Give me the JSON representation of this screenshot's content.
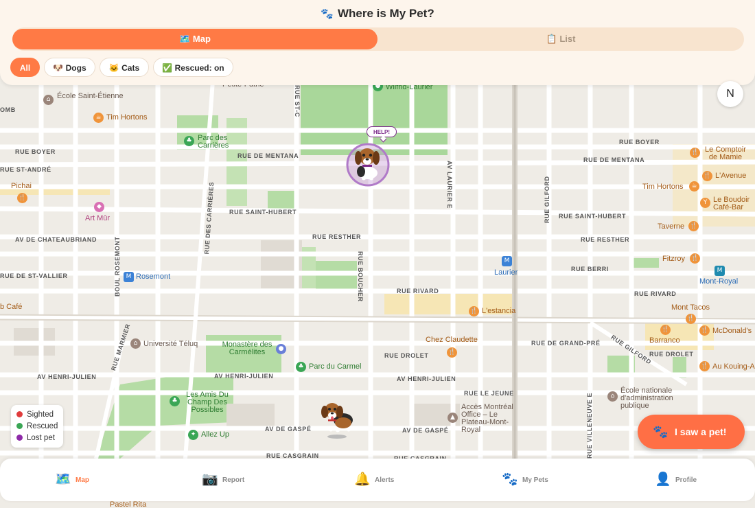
{
  "app": {
    "title": "Where is My Pet?"
  },
  "view_toggle": {
    "map_label": "🗺️ Map",
    "list_label": "📋 List",
    "selected": "Map"
  },
  "filters": [
    {
      "label": "All",
      "active": true
    },
    {
      "label": "🐶 Dogs",
      "active": false
    },
    {
      "label": "🐱 Cats",
      "active": false
    },
    {
      "label": "✅ Rescued: on",
      "active": false
    }
  ],
  "map": {
    "compass": "N",
    "pet_markers": [
      {
        "status": "Lost pet",
        "bubble": "HELP!",
        "icon": "beagle-dog-icon"
      },
      {
        "status": "Sighted",
        "icon": "beagle-dog-icon"
      }
    ],
    "streets": {
      "rue_boyer_w": "RUE BOYER",
      "rue_st_andre": "RUE ST-ANDRÉ",
      "rue_de_mentana_w": "RUE DE MENTANA",
      "rue_saint_hubert_w": "RUE SAINT-HUBERT",
      "rue_resther_w": "RUE RESTHER",
      "av_chateaubriand": "AV DE CHATEAUBRIAND",
      "rue_st_vallier": "RUE DE ST-VALLIER",
      "rue_rivard": "RUE RIVARD",
      "rue_boyer_e": "RUE BOYER",
      "rue_de_mentana_e": "RUE DE MENTANA",
      "rue_saint_hubert_e": "RUE SAINT-HUBERT",
      "rue_resther_e": "RUE RESTHER",
      "rue_berri": "RUE BERRI",
      "rue_rivard_e": "RUE RIVARD",
      "rue_de_grand_pre": "RUE DE GRAND-PRÉ",
      "rue_drolet_w": "RUE DROLET",
      "rue_drolet_e": "RUE DROLET",
      "av_henri_julien_1": "AV HENRI-JULIEN",
      "av_henri_julien_2": "AV HENRI-JULIEN",
      "av_henri_julien_3": "AV HENRI-JULIEN",
      "rue_le_jeune": "RUE LE JEUNE",
      "av_de_gaspe_1": "AV DE GASPÉ",
      "av_de_gaspe_2": "AV DE GASPÉ",
      "rue_casgrain_1": "RUE CASGRAIN",
      "rue_casgrain_2": "RUE CASGRAIN",
      "rue_st_hubert_e2": "RUE SAINT-HUBERT",
      "boul_rosemont": "BOUL ROSEMONT",
      "rue_des_carrieres": "RUE DES CARRIÈRES",
      "rue_boucher": "RUE BOUCHER",
      "av_laurier_e": "AV LAURIER E",
      "rue_gilford_v": "RUE GILFORD",
      "rue_marmier": "RUE MARMIER",
      "rue_gilford_d": "RUE GILFORD",
      "rue_villeneuve_e": "RUE VILLENEUVE E",
      "rue_st_c": "RUE ST-C",
      "ombre": "OMB"
    },
    "pois": {
      "ecole_saint_etienne": "École Saint-Étienne",
      "tim_hortons_w": "Tim Hortons",
      "parc_des_carrieres": "Parc des Carrières",
      "petite_patrie": "Petite-Patrie",
      "wilfrid_laurier": "Wilfrid-Laurier",
      "pichai": "Pichai",
      "art_mur": "Art Mûr",
      "rosemont": "Rosemont",
      "b_cafe": "b Café",
      "universite_teluq": "Université Téluq",
      "monastere": "Monastère des Carmélites",
      "parc_du_carmel": "Parc du Carmel",
      "amis_champ": "Les Amis Du Champ Des Possibles",
      "allez_up": "Allez Up",
      "chez_claudette": "Chez Claudette",
      "l_estancia": "L'estancia",
      "laurier": "Laurier",
      "acces_montreal": "Accès Montréal Office – Le Plateau-Mont-Royal",
      "le_comptoir": "Le Comptoir de Mamie",
      "l_avenue": "L'Avenue",
      "tim_hortons_e": "Tim Hortons",
      "le_boudoir": "Le Boudoir Café-Bar",
      "taverne": "Taverne",
      "fitzroy": "Fitzroy",
      "mont_royal": "Mont-Royal",
      "mont_tacos": "Mont Tacos",
      "barranco": "Barranco",
      "mcdonalds": "McDonald's",
      "au_kouing": "Au Kouing-A",
      "ecole_nationale": "École nationale d'administration publique",
      "pastel_rita": "Pastel Rita"
    }
  },
  "legend": [
    {
      "label": "Sighted",
      "color": "#e03c3c"
    },
    {
      "label": "Rescued",
      "color": "#3aa655"
    },
    {
      "label": "Lost pet",
      "color": "#8e2aa8"
    }
  ],
  "fab": {
    "label": "I saw a pet!",
    "icon": "paw-icon"
  },
  "tabs": [
    {
      "label": "Map",
      "icon": "map-icon",
      "active": true
    },
    {
      "label": "Report",
      "icon": "camera-icon",
      "active": false
    },
    {
      "label": "Alerts",
      "icon": "bell-icon",
      "active": false
    },
    {
      "label": "My Pets",
      "icon": "paws-icon",
      "active": false
    },
    {
      "label": "Profile",
      "icon": "person-icon",
      "active": false
    }
  ]
}
